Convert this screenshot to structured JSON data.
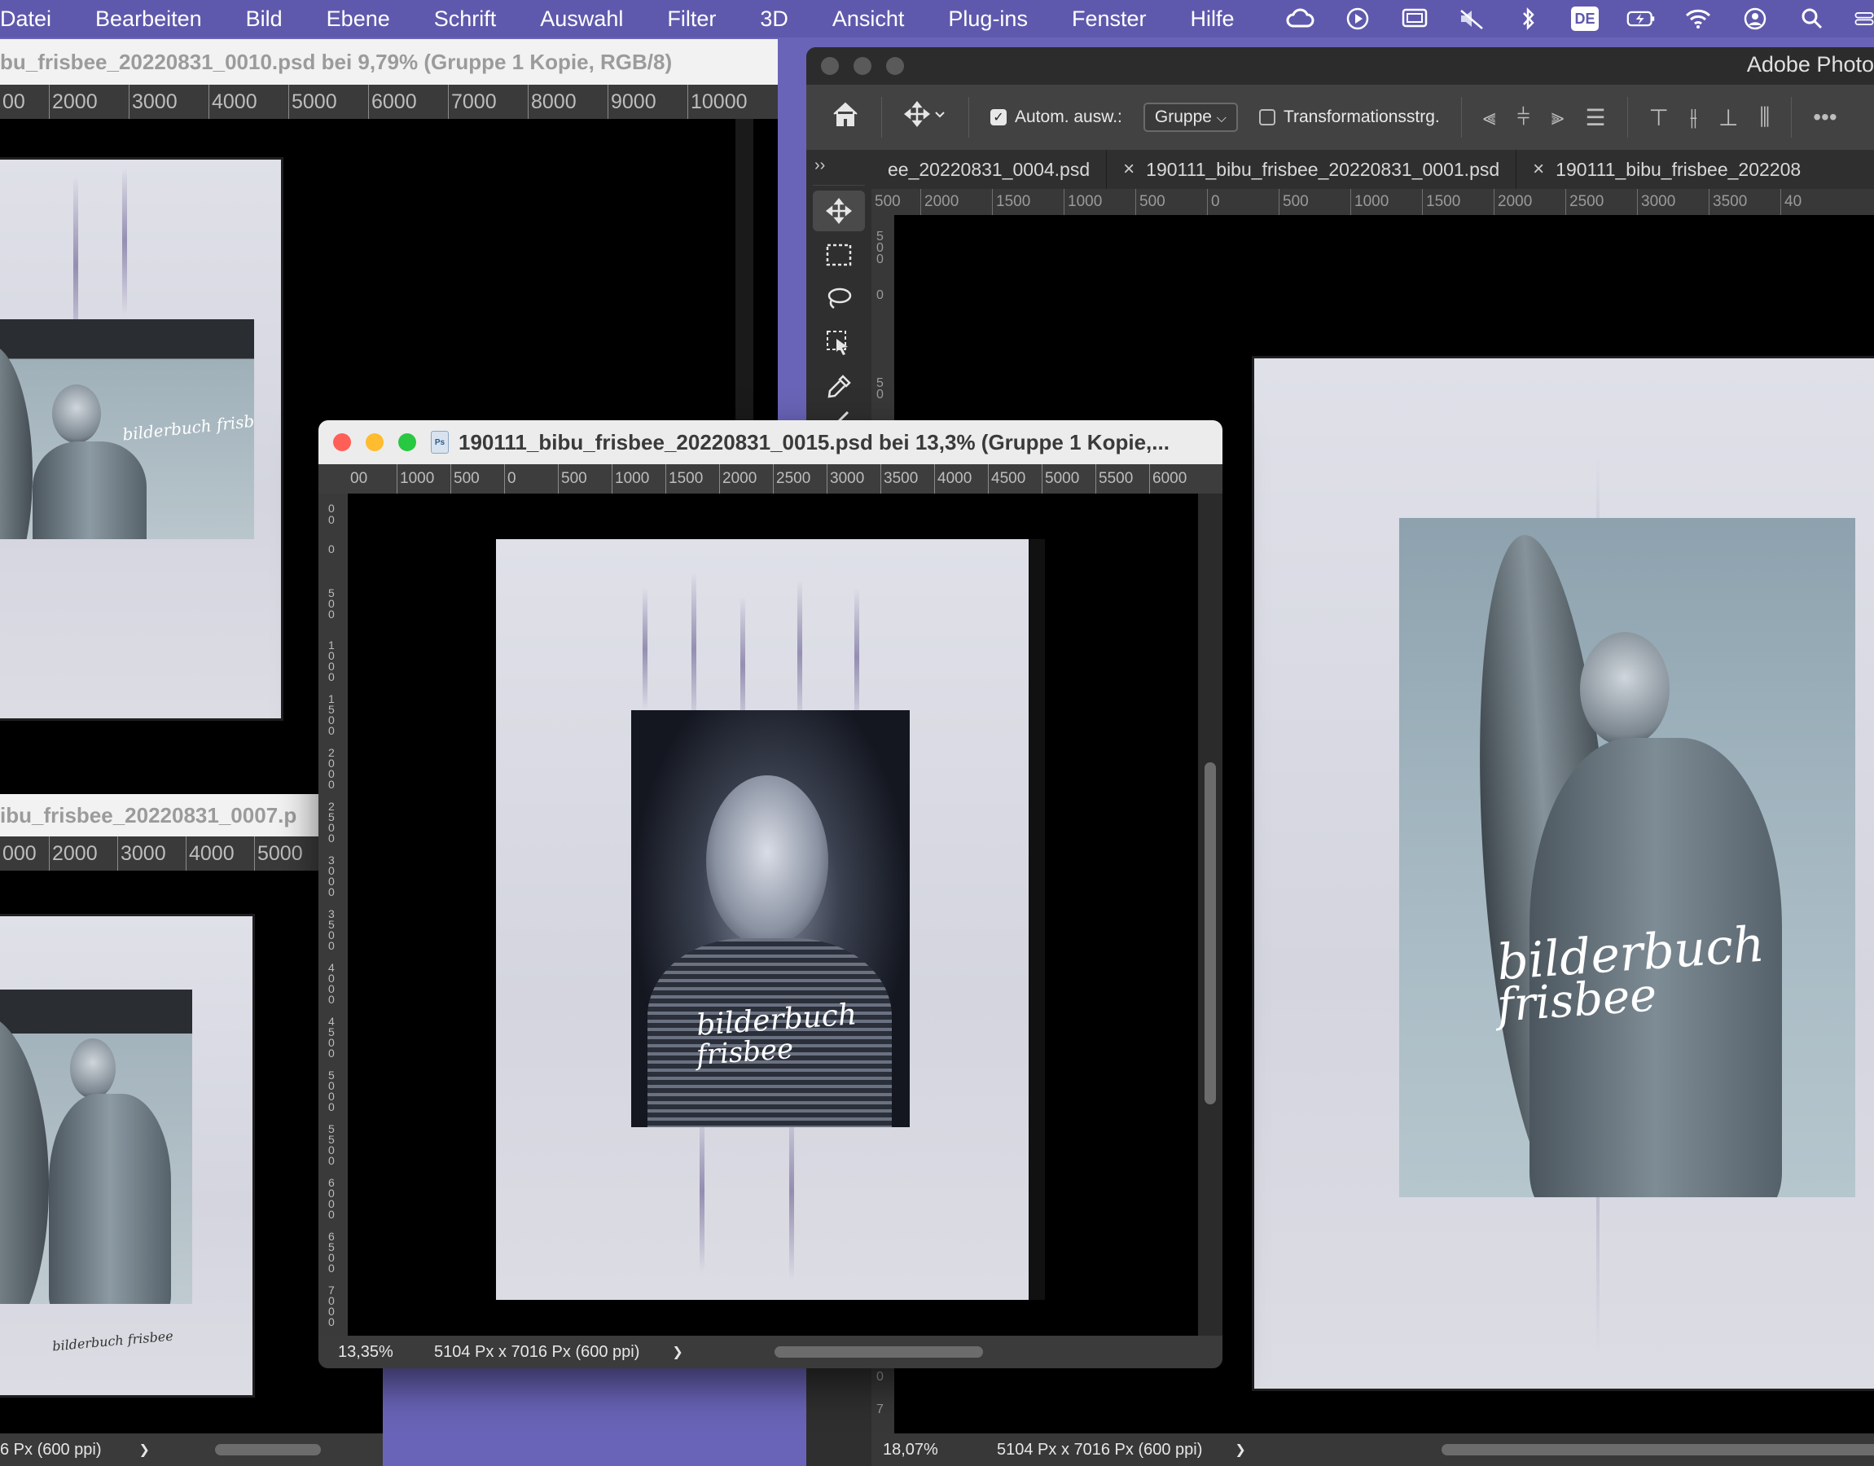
{
  "menubar": {
    "items": [
      "Datei",
      "Bearbeiten",
      "Bild",
      "Ebene",
      "Schrift",
      "Auswahl",
      "Filter",
      "3D",
      "Ansicht",
      "Plug-ins",
      "Fenster",
      "Hilfe"
    ],
    "lang": "DE"
  },
  "win_a": {
    "title": "bu_frisbee_20220831_0010.psd bei 9,79% (Gruppe 1 Kopie, RGB/8)",
    "ruler": [
      "00",
      "2000",
      "3000",
      "4000",
      "5000",
      "6000",
      "7000",
      "8000",
      "9000",
      "10000"
    ],
    "scribble": "bilderbuch frisbee"
  },
  "win_b": {
    "title": "ibu_frisbee_20220831_0007.p",
    "ruler": [
      "000",
      "2000",
      "3000",
      "4000",
      "5000"
    ],
    "status_size": "6 Px (600 ppi)",
    "status_arrow": "❯",
    "scribble": "bilderbuch frisbee"
  },
  "win_c": {
    "title": "190111_bibu_frisbee_20220831_0015.psd bei 13,3% (Gruppe 1 Kopie,...",
    "ruler": [
      "00",
      "1000",
      "500",
      "0",
      "500",
      "1000",
      "1500",
      "2000",
      "2500",
      "3000",
      "3500",
      "4000",
      "4500",
      "5000",
      "5500",
      "6000"
    ],
    "vruler": [
      "0",
      "0",
      "0",
      "5 0 0",
      "1 0 0 0",
      "1 5 0 0",
      "2 0 0 0",
      "2 5 0 0",
      "3 0 0 0",
      "3 5 0 0",
      "4 0 0 0",
      "4 5 0 0",
      "5 0 0 0",
      "5 5 0 0",
      "6 0 0 0",
      "6 5 0 0",
      "7 0 0 0"
    ],
    "zoom": "13,35%",
    "size": "5104 Px x 7016 Px (600 ppi)",
    "status_arrow": "❯",
    "scribble_line1": "bilderbuch",
    "scribble_line2": "frisbee"
  },
  "app": {
    "title": "Adobe Photo",
    "options": {
      "auto_select_label": "Autom. ausw.:",
      "auto_select_value": "Gruppe",
      "transform_label": "Transformationsstrg.",
      "more": "•••"
    },
    "tabs": [
      {
        "label": "ee_20220831_0004.psd",
        "close": ""
      },
      {
        "label": "190111_bibu_frisbee_20220831_0001.psd",
        "close": "×"
      },
      {
        "label": "190111_bibu_frisbee_202208",
        "close": "×"
      }
    ],
    "toolbox_expand": "››",
    "ruler": [
      "500",
      "2000",
      "1500",
      "1000",
      "500",
      "0",
      "500",
      "1000",
      "1500",
      "2000",
      "2500",
      "3000",
      "3500",
      "40"
    ],
    "vruler": [
      "5 0 0",
      "0",
      "5 0",
      "0",
      "7"
    ],
    "zoom": "18,07%",
    "size": "5104 Px x 7016 Px (600 ppi)",
    "status_arrow": "❯",
    "scribble_line1": "bilderbuch",
    "scribble_line2": "frisbee"
  },
  "icons": {
    "creative_cloud": "creative-cloud-icon",
    "play": "play-icon",
    "display": "display-icon",
    "mute": "mute-icon",
    "bluetooth": "bluetooth-icon",
    "battery": "battery-icon",
    "wifi": "wifi-icon",
    "user": "user-icon",
    "search": "search-icon",
    "control_center": "control-center-icon"
  },
  "colors": {
    "desktop": "#6a64b8",
    "menubar": "#5f59ad",
    "close": "#ff5f57",
    "minimize": "#febc2e",
    "zoom": "#28c840"
  }
}
